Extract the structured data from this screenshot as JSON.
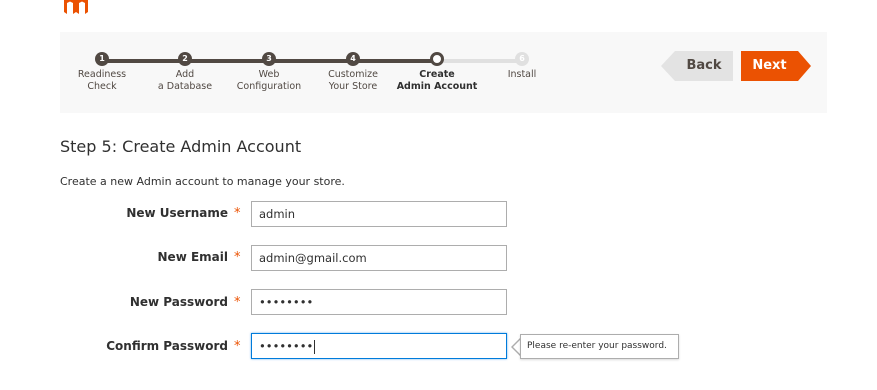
{
  "brand": {
    "logo": "magento-logo-icon",
    "accent_color": "#eb5202",
    "dark_color": "#514943"
  },
  "progress": {
    "steps": [
      {
        "number": "1",
        "label": "Readiness\nCheck",
        "state": "done"
      },
      {
        "number": "2",
        "label": "Add\na Database",
        "state": "done"
      },
      {
        "number": "3",
        "label": "Web\nConfiguration",
        "state": "done"
      },
      {
        "number": "4",
        "label": "Customize\nYour Store",
        "state": "done"
      },
      {
        "number": "",
        "label": "Create\nAdmin Account",
        "state": "current"
      },
      {
        "number": "6",
        "label": "Install",
        "state": "pending"
      }
    ]
  },
  "nav": {
    "back_label": "Back",
    "next_label": "Next"
  },
  "page": {
    "title": "Step 5: Create Admin Account",
    "intro": "Create a new Admin account to manage your store."
  },
  "form": {
    "required_mark": "*",
    "username": {
      "label": "New Username",
      "value": "admin"
    },
    "email": {
      "label": "New Email",
      "value": "admin@gmail.com"
    },
    "password": {
      "label": "New Password",
      "value": "••••••••"
    },
    "confirm_password": {
      "label": "Confirm Password",
      "value": "••••••••",
      "focused": true
    },
    "tooltip": "Please re-enter your password."
  }
}
